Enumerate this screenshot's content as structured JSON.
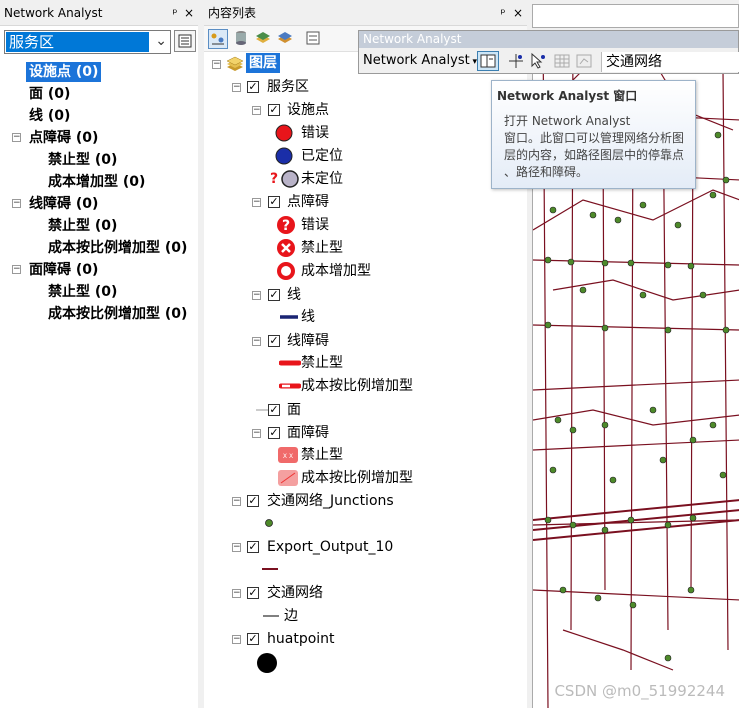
{
  "na_pane": {
    "title": "Network Analyst",
    "pin": "ᵖ",
    "close": "×",
    "selected_analysis": "服务区",
    "tree": [
      {
        "label": "设施点 (0)",
        "level": 1,
        "selected": true
      },
      {
        "label": "面 (0)",
        "level": 1
      },
      {
        "label": "线 (0)",
        "level": 1
      },
      {
        "label": "点障碍 (0)",
        "level": 0,
        "expand": "−"
      },
      {
        "label": "禁止型 (0)",
        "level": 2
      },
      {
        "label": "成本增加型 (0)",
        "level": 2
      },
      {
        "label": "线障碍 (0)",
        "level": 0,
        "expand": "−"
      },
      {
        "label": "禁止型 (0)",
        "level": 2
      },
      {
        "label": "成本按比例增加型 (0)",
        "level": 2
      },
      {
        "label": "面障碍 (0)",
        "level": 0,
        "expand": "−"
      },
      {
        "label": "禁止型 (0)",
        "level": 2
      },
      {
        "label": "成本按比例增加型 (0)",
        "level": 2
      }
    ]
  },
  "toc": {
    "title": "内容列表",
    "pin": "ᵖ",
    "close": "×",
    "layers_label": "图层",
    "service_area": "服务区",
    "facilities": "设施点",
    "fac_error": "错误",
    "fac_located": "已定位",
    "fac_unlocated": "未定位",
    "point_barriers": "点障碍",
    "pb_error": "错误",
    "pb_restriction": "禁止型",
    "pb_added_cost": "成本增加型",
    "lines": "线",
    "lines_sym": "线",
    "line_barriers": "线障碍",
    "lb_restriction": "禁止型",
    "lb_scaled": "成本按比例增加型",
    "polygons": "面",
    "polygon_barriers": "面障碍",
    "polyb_restriction": "禁止型",
    "polyb_scaled": "成本按比例增加型",
    "junctions": "交通网络_Junctions",
    "export": "Export_Output_10",
    "network": "交通网络",
    "edges": "边",
    "huatpoint": "huatpoint",
    "unlocated_q": "?"
  },
  "na_toolbar": {
    "title": "Network Analyst",
    "menu_label": "Network Analyst",
    "network_dataset": "交通网络"
  },
  "tooltip": {
    "title": "Network Analyst 窗口",
    "line1": "打开 Network Analyst",
    "line2": "窗口。此窗口可以管理网络分析图",
    "line3": "层的内容，如路径图层中的停靠点",
    "line4": "、路径和障碍。"
  },
  "watermark": "CSDN @m0_51992244",
  "colors": {
    "selection": "#1c74d9",
    "network_edge": "#7a1020",
    "junction": "#4e8a2a",
    "error_red": "#e8151b",
    "located_blue": "#1a2ea8"
  }
}
